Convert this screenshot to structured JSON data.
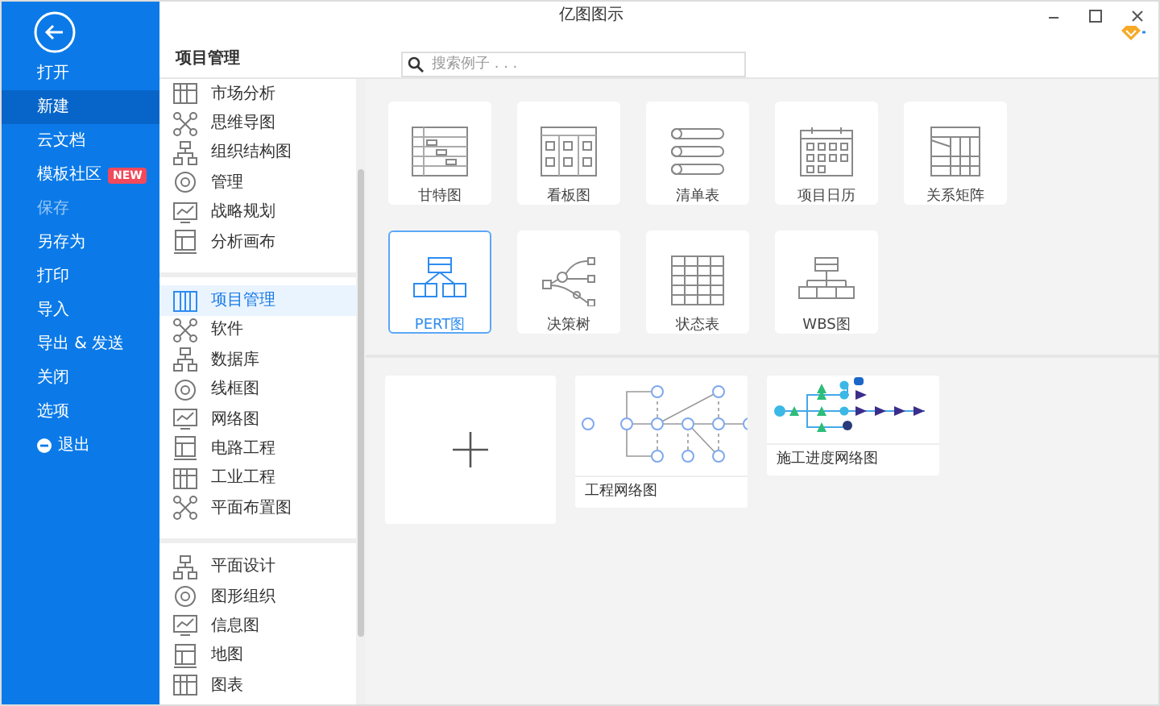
{
  "window": {
    "title": "亿图图示"
  },
  "sidebar": {
    "items": [
      {
        "label": "打开",
        "selected": false,
        "disabled": false
      },
      {
        "label": "新建",
        "selected": true,
        "disabled": false
      },
      {
        "label": "云文档",
        "selected": false,
        "disabled": false
      },
      {
        "label": "模板社区",
        "selected": false,
        "disabled": false,
        "badge": "NEW"
      },
      {
        "label": "保存",
        "selected": false,
        "disabled": true
      },
      {
        "label": "另存为",
        "selected": false,
        "disabled": false
      },
      {
        "label": "打印",
        "selected": false,
        "disabled": false
      },
      {
        "label": "导入",
        "selected": false,
        "disabled": false
      },
      {
        "label": "导出 & 发送",
        "selected": false,
        "disabled": false
      },
      {
        "label": "关闭",
        "selected": false,
        "disabled": false
      },
      {
        "label": "选项",
        "selected": false,
        "disabled": false
      },
      {
        "label": "退出",
        "selected": false,
        "disabled": false,
        "kind": "exit"
      }
    ]
  },
  "category_panel": {
    "title": "项目管理",
    "groups": [
      {
        "items": [
          {
            "label": "市场分析",
            "selected": false
          },
          {
            "label": "思维导图",
            "selected": false
          },
          {
            "label": "组织结构图",
            "selected": false
          },
          {
            "label": "管理",
            "selected": false
          },
          {
            "label": "战略规划",
            "selected": false
          },
          {
            "label": "分析画布",
            "selected": false
          }
        ]
      },
      {
        "items": [
          {
            "label": "项目管理",
            "selected": true
          },
          {
            "label": "软件",
            "selected": false
          },
          {
            "label": "数据库",
            "selected": false
          },
          {
            "label": "线框图",
            "selected": false
          },
          {
            "label": "网络图",
            "selected": false
          },
          {
            "label": "电路工程",
            "selected": false
          },
          {
            "label": "工业工程",
            "selected": false
          },
          {
            "label": "平面布置图",
            "selected": false
          }
        ]
      },
      {
        "items": [
          {
            "label": "平面设计",
            "selected": false
          },
          {
            "label": "图形组织",
            "selected": false
          },
          {
            "label": "信息图",
            "selected": false
          },
          {
            "label": "地图",
            "selected": false
          },
          {
            "label": "图表",
            "selected": false
          }
        ]
      }
    ]
  },
  "search": {
    "placeholder": "搜索例子 . . ."
  },
  "templates": [
    {
      "label": "甘特图",
      "selected": false
    },
    {
      "label": "看板图",
      "selected": false
    },
    {
      "label": "清单表",
      "selected": false
    },
    {
      "label": "项目日历",
      "selected": false
    },
    {
      "label": "关系矩阵",
      "selected": false
    },
    {
      "label": "PERT图",
      "selected": true
    },
    {
      "label": "决策树",
      "selected": false
    },
    {
      "label": "状态表",
      "selected": false
    },
    {
      "label": "WBS图",
      "selected": false
    }
  ],
  "examples": [
    {
      "kind": "new"
    },
    {
      "kind": "example",
      "label": "工程网络图"
    },
    {
      "kind": "example",
      "label": "施工进度网络图"
    }
  ]
}
